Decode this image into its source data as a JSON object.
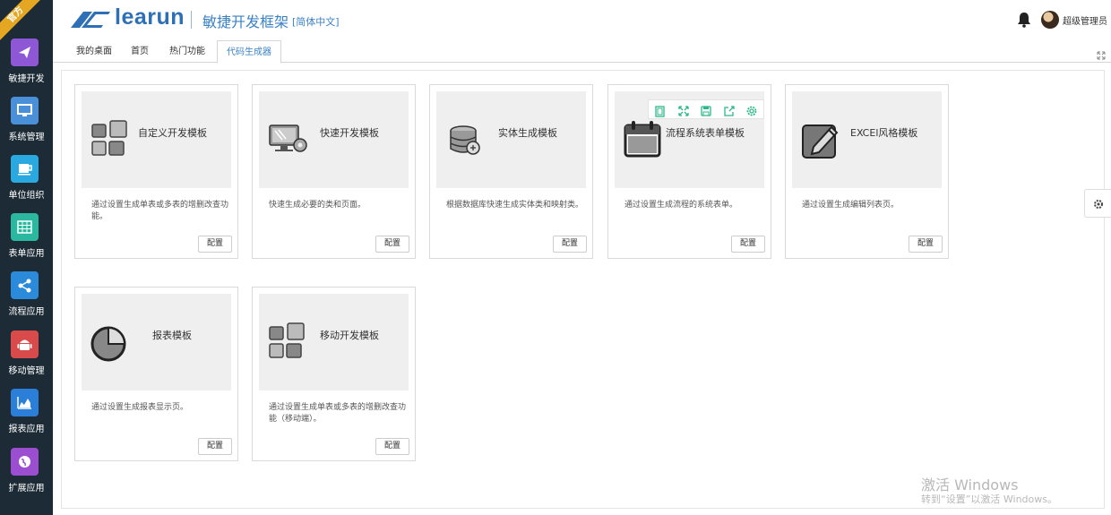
{
  "badge": "官方",
  "sidebar": {
    "items": [
      {
        "label": "敏捷开发",
        "icon": "paper-plane-icon",
        "color": "#8e57d6"
      },
      {
        "label": "系统管理",
        "icon": "monitor-icon",
        "color": "#4a90d9"
      },
      {
        "label": "单位组织",
        "icon": "coffee-cup-icon",
        "color": "#2aa8e0"
      },
      {
        "label": "表单应用",
        "icon": "table-grid-icon",
        "color": "#2bb8a0"
      },
      {
        "label": "流程应用",
        "icon": "share-nodes-icon",
        "color": "#2b8ad9"
      },
      {
        "label": "移动管理",
        "icon": "android-icon",
        "color": "#d94a4a"
      },
      {
        "label": "报表应用",
        "icon": "area-chart-icon",
        "color": "#2b7fd9"
      },
      {
        "label": "扩展应用",
        "icon": "globe-icon",
        "color": "#9b4fd0"
      }
    ]
  },
  "header": {
    "logo": "learun",
    "product": "敏捷开发框架",
    "lang": "[简体中文]",
    "username": "超级管理员"
  },
  "tabs": [
    "我的桌面",
    "首页",
    "热门功能",
    "代码生成器"
  ],
  "cards": [
    {
      "title": "自定义开发模板",
      "desc": "通过设置生成单表或多表的增删改查功能。",
      "btn": "配置",
      "icon": "grid-blocks-icon"
    },
    {
      "title": "快速开发模板",
      "desc": "快速生成必要的类和页面。",
      "btn": "配置",
      "icon": "monitor-gear-icon"
    },
    {
      "title": "实体生成模板",
      "desc": "根据数据库快速生成实体类和映射类。",
      "btn": "配置",
      "icon": "database-icon"
    },
    {
      "title": "流程系统表单模板",
      "desc": "通过设置生成流程的系统表单。",
      "btn": "配置",
      "icon": "calendar-icon"
    },
    {
      "title": "EXCEl风格模板",
      "desc": "通过设置生成编辑列表页。",
      "btn": "配置",
      "icon": "edit-pen-icon"
    },
    {
      "title": "报表模板",
      "desc": "通过设置生成报表显示页。",
      "btn": "配置",
      "icon": "pie-chart-icon"
    },
    {
      "title": "移动开发模板",
      "desc": "通过设置生成单表或多表的增删改查功能（移动端）。",
      "btn": "配置",
      "icon": "grid-blocks-icon"
    }
  ],
  "watermark": {
    "line1": "激活 Windows",
    "line2": "转到“设置”以激活 Windows。"
  }
}
